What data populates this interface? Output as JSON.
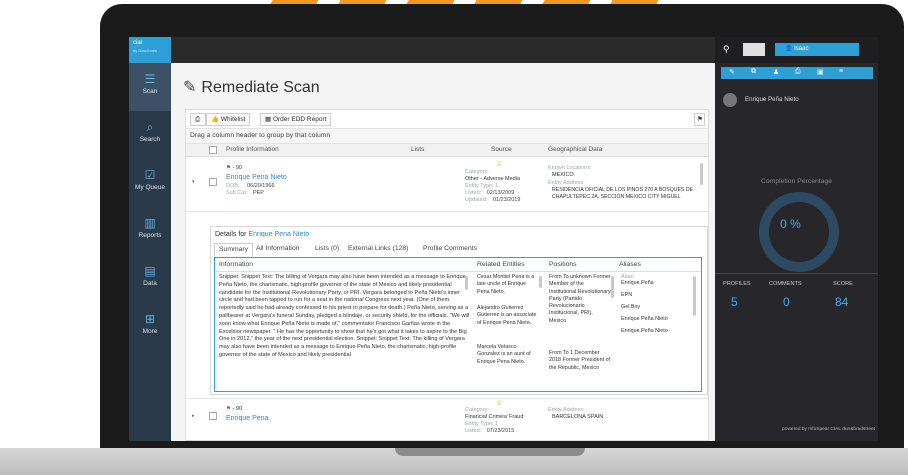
{
  "app": {
    "brand": "cial",
    "brand_sub": "by DowJones",
    "page_title": "Remediate Scan"
  },
  "nav": [
    {
      "label": "Scan",
      "icon": "list-icon"
    },
    {
      "label": "Search",
      "icon": "binoculars-icon"
    },
    {
      "label": "My Queue",
      "icon": "checkbox-icon"
    },
    {
      "label": "Reports",
      "icon": "bar-chart-icon"
    },
    {
      "label": "Data",
      "icon": "database-icon"
    },
    {
      "label": "More",
      "icon": "plus-icon"
    }
  ],
  "toolbar": {
    "whitelist_label": "Whitelist",
    "order_label": "Order EDD Report",
    "group_hint": "Drag a column header to group by that column"
  },
  "columns": [
    "Profile Information",
    "Lists",
    "Source",
    "Geographical Data"
  ],
  "rows": [
    {
      "score": "- 90",
      "name": "Enrique Pena Nieto",
      "dob_label": "DOB:",
      "dob": "06/20/1966",
      "subcat_label": "Sub Cat:",
      "subcat": "PEP",
      "category_label": "Category:",
      "category": "Other - Adverse Media",
      "entity_type_label": "Entity Type:",
      "entity_type": "1",
      "listed_label": "Listed:",
      "listed": "02/13/2009",
      "updated_label": "Updated:",
      "updated": "01/23/2019",
      "known_locations_label": "Known Locations:",
      "known_locations": "MEXICO",
      "entity_address_label": "Entity Address:",
      "entity_address": "RESIDENCIA OFICIAL DE LOS PINOS 270 A BOSQUES DE CHAPULTEPEC 2A. SECCIÓN MEXICO CITY MIGUEL"
    },
    {
      "score": "- 90",
      "name": "Enrique Pena",
      "category_label": "Category:",
      "category": "Financial Crimes/ Fraud",
      "entity_type_label": "Entity Type:",
      "entity_type": "1",
      "listed_label": "Listed:",
      "listed": "07/23/2015",
      "entity_address_label": "Entity Address:",
      "entity_address": "BARCELONA SPAIN"
    }
  ],
  "details": {
    "prefix": "Details for",
    "name": "Enrique Pena Nieto",
    "tabs": [
      "Summary",
      "All Information",
      "Lists (0)",
      "External Links (128)",
      "Profile Comments"
    ],
    "headers": [
      "Information",
      "Related Entities",
      "Positions",
      "Aliases"
    ],
    "information": "Snippet: Snippet Text: The billing of Vergara may also have been intended as a message to Enrique Peña Nieto, the charismatic, high-profile governor of the state of Mexico and likely presidential candidate for the Institutional Revolutionary Party, or PRI. Vergara belonged to Peña Nieto's inner circle and had been tapped to run for a seat in the national Congress next year. (One of them reportedly said he had already confessed to his priest to prepare for death.) Peña Nieto, serving as a pallbearer at Vergara's funeral Sunday, pledged a blindaje, or security shield, for the officials. \"We will soon know what Enrique Peña Nieto is made of,\" commentator Francisco Garfias wrote in the Excelsior newspaper. \" He has the opportunity to show that he's got what it takes to aspire to the Big One in 2012,\" the year of the next presidential election. Snippet: Snippet Text: The killing of Vergara may also have been intended as a message to Enrique Peña Nieto, the charismatic, high-profile governor of the state of Mexico and likely presidential",
    "related_entities": [
      "Cesar Montiel Pena is a late uncle of Enrique Pena Nieto.",
      "Alejandro Gutierrez Gutierrez is an associate of Enrique Pena Nieto.",
      "Marcela Velasco Gonzalez is an aunt of Enrique Pena Nieto."
    ],
    "positions": [
      "From To unknown Former Member of the Institutional Revolutionary Party (Partido Revolucionario Institucional, PRI), Mexico",
      "From To 1 December 2018 Former President of the Republic, Mexico"
    ],
    "aliases_label": "Alias:",
    "aliases": [
      "Enrique Peña",
      "EPN",
      "Gel Boy",
      "Enrique Peña Nieto",
      "Enrique Peña Nieto"
    ]
  },
  "right_panel": {
    "user": "Enrique Peña Nieto",
    "user_top": "Isaac",
    "completion_label": "Completion Percentage",
    "completion": "0 %",
    "stats": [
      {
        "label": "PROFILES",
        "value": "5"
      },
      {
        "label": "COMMENTS",
        "value": "0"
      },
      {
        "label": "SCORE",
        "value": "84"
      }
    ],
    "footer": "powered by  InfoSpear  CIAL  dun&bradstreet"
  },
  "colors": {
    "accent": "#2f9fd8",
    "brand_orange": "#f39a1e",
    "dark_panel": "#27272b",
    "nav_bg": "#2b3a4a"
  }
}
